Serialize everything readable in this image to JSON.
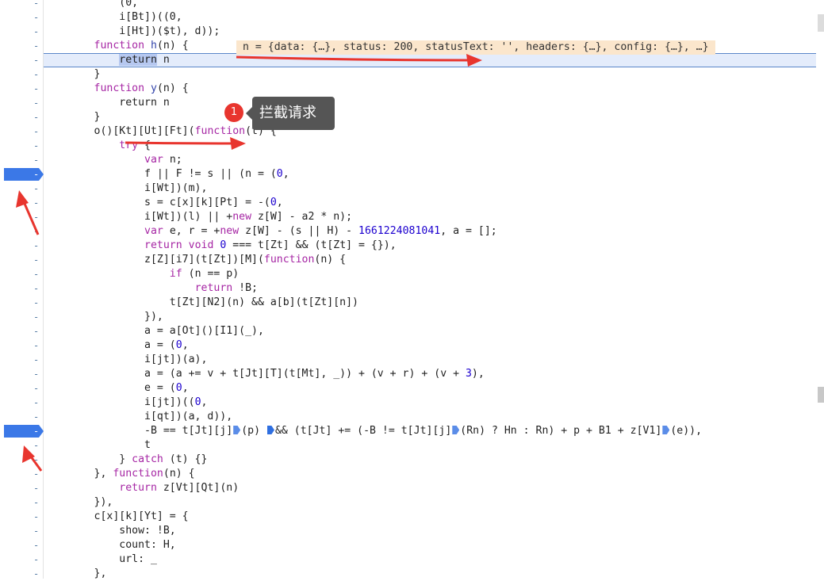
{
  "gutter": {
    "dash": "-",
    "breakpoint_lines": [
      12,
      30
    ]
  },
  "code_lines": [
    [
      [
        "pl",
        "            (0,"
      ]
    ],
    [
      [
        "pl",
        "            i[Bt])((0,"
      ]
    ],
    [
      [
        "pl",
        "            i[Ht])($t), d));"
      ]
    ],
    [
      [
        "pl",
        "        "
      ],
      [
        "kw",
        "function"
      ],
      [
        "pl",
        " "
      ],
      [
        "fn",
        "h"
      ],
      [
        "pl",
        "(n) {"
      ]
    ],
    [
      [
        "pl",
        "            "
      ],
      [
        "sel",
        "return"
      ],
      [
        "pl",
        " n"
      ]
    ],
    [
      [
        "pl",
        "        }"
      ]
    ],
    [
      [
        "pl",
        "        "
      ],
      [
        "kw",
        "function"
      ],
      [
        "pl",
        " "
      ],
      [
        "fn",
        "y"
      ],
      [
        "pl",
        "(n) {"
      ]
    ],
    [
      [
        "pl",
        "            return n"
      ]
    ],
    [
      [
        "pl",
        "        }"
      ]
    ],
    [
      [
        "pl",
        "        o()[Kt][Ut][Ft]("
      ],
      [
        "kw",
        "function"
      ],
      [
        "pl",
        "(t) {"
      ]
    ],
    [
      [
        "pl",
        "            "
      ],
      [
        "kw",
        "try"
      ],
      [
        "pl",
        " {"
      ]
    ],
    [
      [
        "pl",
        "                "
      ],
      [
        "kw",
        "var"
      ],
      [
        "pl",
        " n;"
      ]
    ],
    [
      [
        "pl",
        "                f || F != s || (n = ("
      ],
      [
        "num",
        "0"
      ],
      [
        "pl",
        ","
      ]
    ],
    [
      [
        "pl",
        "                i[Wt])(m),"
      ]
    ],
    [
      [
        "pl",
        "                s = c[x][k][Pt] = -("
      ],
      [
        "num",
        "0"
      ],
      [
        "pl",
        ","
      ]
    ],
    [
      [
        "pl",
        "                i[Wt])(l) || +"
      ],
      [
        "kw",
        "new"
      ],
      [
        "pl",
        " z[W] - a2 * n);"
      ]
    ],
    [
      [
        "pl",
        "                "
      ],
      [
        "kw",
        "var"
      ],
      [
        "pl",
        " e, r = +"
      ],
      [
        "kw",
        "new"
      ],
      [
        "pl",
        " z[W] - (s || H) - "
      ],
      [
        "num",
        "1661224081041"
      ],
      [
        "pl",
        ", a = [];"
      ]
    ],
    [
      [
        "pl",
        "                "
      ],
      [
        "kw",
        "return"
      ],
      [
        "pl",
        " "
      ],
      [
        "kw",
        "void"
      ],
      [
        "pl",
        " "
      ],
      [
        "num",
        "0"
      ],
      [
        "pl",
        " === t[Zt] && (t[Zt] = {}),"
      ]
    ],
    [
      [
        "pl",
        "                z[Z][i7](t[Zt])[M]("
      ],
      [
        "kw",
        "function"
      ],
      [
        "pl",
        "(n) {"
      ]
    ],
    [
      [
        "pl",
        "                    "
      ],
      [
        "kw",
        "if"
      ],
      [
        "pl",
        " (n == p)"
      ]
    ],
    [
      [
        "pl",
        "                        "
      ],
      [
        "kw",
        "return"
      ],
      [
        "pl",
        " !B;"
      ]
    ],
    [
      [
        "pl",
        "                    t[Zt][N2](n) && a[b](t[Zt][n])"
      ]
    ],
    [
      [
        "pl",
        "                }),"
      ]
    ],
    [
      [
        "pl",
        "                a = a[Ot]()[I1](_),"
      ]
    ],
    [
      [
        "pl",
        "                a = ("
      ],
      [
        "num",
        "0"
      ],
      [
        "pl",
        ","
      ]
    ],
    [
      [
        "pl",
        "                i[jt])(a),"
      ]
    ],
    [
      [
        "pl",
        "                a = (a += v + t[Jt][T](t[Mt], _)) + (v + r) + (v + "
      ],
      [
        "num",
        "3"
      ],
      [
        "pl",
        "),"
      ]
    ],
    [
      [
        "pl",
        "                e = ("
      ],
      [
        "num",
        "0"
      ],
      [
        "pl",
        ","
      ]
    ],
    [
      [
        "pl",
        "                i[jt])(("
      ],
      [
        "num",
        "0"
      ],
      [
        "pl",
        ","
      ]
    ],
    [
      [
        "pl",
        "                i[qt])(a, d)),"
      ]
    ],
    [
      [
        "pl",
        "                -B == t[Jt][j]"
      ],
      [
        "io",
        ""
      ],
      [
        "pl",
        "(p) "
      ],
      [
        "is",
        ""
      ],
      [
        "pl",
        "&& (t[Jt] += (-B != t[Jt][j]"
      ],
      [
        "io",
        ""
      ],
      [
        "pl",
        "(Rn) ? Hn : Rn) + p + B1 + z[V1]"
      ],
      [
        "io",
        ""
      ],
      [
        "pl",
        "(e)),"
      ]
    ],
    [
      [
        "pl",
        "                t"
      ]
    ],
    [
      [
        "pl",
        "            } "
      ],
      [
        "kw",
        "catch"
      ],
      [
        "pl",
        " (t) {}"
      ]
    ],
    [
      [
        "pl",
        "        }, "
      ],
      [
        "kw",
        "function"
      ],
      [
        "pl",
        "(n) {"
      ]
    ],
    [
      [
        "pl",
        "            "
      ],
      [
        "kw",
        "return"
      ],
      [
        "pl",
        " z[Vt][Qt](n)"
      ]
    ],
    [
      [
        "pl",
        "        }),"
      ]
    ],
    [
      [
        "pl",
        "        c[x][k][Yt] = {"
      ]
    ],
    [
      [
        "pl",
        "            show: !B,"
      ]
    ],
    [
      [
        "pl",
        "            count: H,"
      ]
    ],
    [
      [
        "pl",
        "            url: _"
      ]
    ],
    [
      [
        "pl",
        "        },"
      ]
    ]
  ],
  "highlight_line": 4,
  "hover_popup": "n = {data: {…}, status: 200, statusText: '', headers: {…}, config: {…}, …}",
  "annotation": {
    "badge": "1",
    "text": "拦截请求"
  },
  "colors": {
    "keyword": "#a626a4",
    "number": "#1c00cf",
    "breakpoint": "#3b78e7",
    "arrow": "#e8352e",
    "highlight_bg": "#e4ecfb"
  }
}
